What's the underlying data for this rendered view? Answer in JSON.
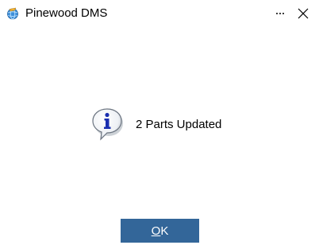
{
  "window": {
    "title": "Pinewood DMS",
    "app_icon": "globe-app-icon",
    "more_label": "...",
    "close_icon": "close-icon"
  },
  "dialog": {
    "icon": "info-icon",
    "message": "2 Parts Updated",
    "ok_mnemonic": "O",
    "ok_rest": "K"
  },
  "colors": {
    "button_bg": "#336699",
    "button_text": "#ffffff",
    "info_blue": "#1a2fb0"
  }
}
